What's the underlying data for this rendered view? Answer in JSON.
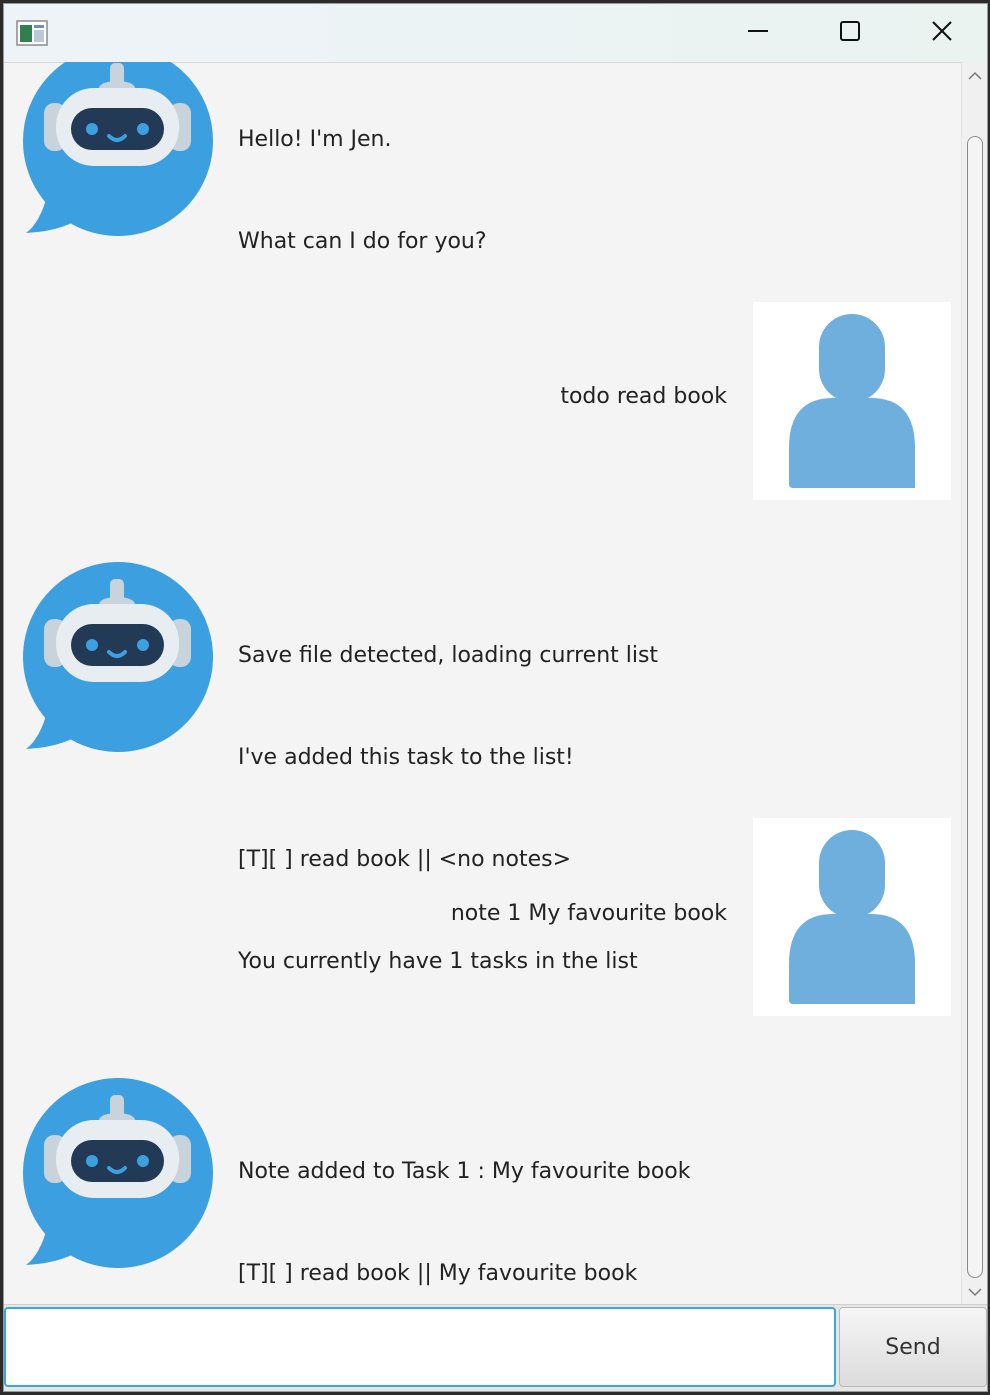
{
  "window": {
    "icons": {
      "app": "app-window-icon",
      "minimize": "minimize-icon",
      "maximize": "maximize-icon",
      "close": "close-icon"
    }
  },
  "messages": [
    {
      "sender": "bot",
      "lines": [
        "Hello! I'm Jen.",
        "What can I do for you?"
      ]
    },
    {
      "sender": "user",
      "lines": [
        "todo read book"
      ]
    },
    {
      "sender": "bot",
      "lines": [
        "Save file detected, loading current list",
        "I've added this task to the list!",
        "[T][ ] read book || <no notes>",
        "You currently have 1 tasks in the list"
      ]
    },
    {
      "sender": "user",
      "lines": [
        "note 1 My favourite book"
      ]
    },
    {
      "sender": "bot",
      "lines": [
        "Note added to Task 1 : My favourite book",
        "[T][ ] read book || My favourite book"
      ]
    }
  ],
  "input": {
    "value": "",
    "placeholder": ""
  },
  "send_button": {
    "label": "Send"
  },
  "colors": {
    "bot_bubble": "#3c9fe0",
    "user_avatar": "#6fafde",
    "input_focus": "#39a9d6"
  }
}
